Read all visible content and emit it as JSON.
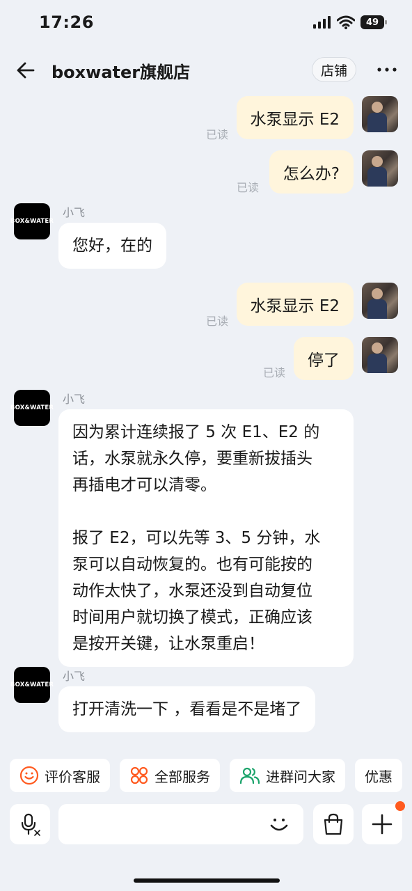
{
  "status_bar": {
    "time": "17:26",
    "battery": "49"
  },
  "header": {
    "title": "boxwater旗舰店",
    "shop_label": "店铺"
  },
  "shop_avatar_text": "BOX&WATER",
  "read_label": "已读",
  "messages": [
    {
      "side": "right",
      "text": "水泵显示 E2"
    },
    {
      "side": "right",
      "text": "怎么办?"
    },
    {
      "side": "left",
      "sender": "小飞",
      "text": "您好，在的"
    },
    {
      "side": "right",
      "text": "水泵显示 E2"
    },
    {
      "side": "right",
      "text": "停了"
    },
    {
      "side": "left",
      "sender": "小飞",
      "lines": [
        "因为累计连续报了 5 次 E1、E2 的",
        "话，水泵就永久停，要重新拔插头",
        "再插电才可以清零。",
        "报了 E2，可以先等 3、5 分钟，水",
        "泵可以自动恢复的。也有可能按的",
        "动作太快了，水泵还没到自动复位",
        "时间用户就切换了模式，正确应该",
        "是按开关键，让水泵重启！"
      ]
    },
    {
      "side": "left",
      "sender": "小飞",
      "text": "打开清洗一下 ，看看是不是堵了"
    }
  ],
  "quick_actions": [
    {
      "label": "评价客服",
      "icon": "smile-icon"
    },
    {
      "label": "全部服务",
      "icon": "grid-icon"
    },
    {
      "label": "进群问大家",
      "icon": "group-icon"
    },
    {
      "label": "优惠",
      "icon": "coupon-icon"
    }
  ],
  "colors": {
    "bubble_me": "#fff5dc",
    "bubble_them": "#ffffff",
    "background": "#eef1f6",
    "accent_orange": "#ff5a1f",
    "accent_green": "#1aa36a"
  }
}
